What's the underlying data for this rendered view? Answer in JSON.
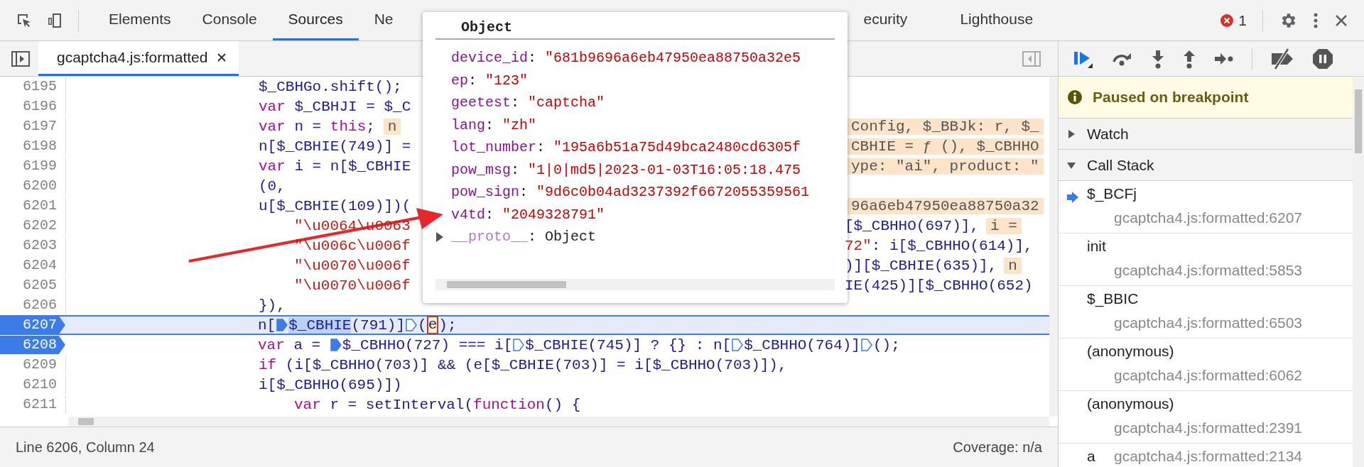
{
  "toolbar": {
    "tabs": [
      {
        "label": "Elements",
        "selected": false
      },
      {
        "label": "Console",
        "selected": false
      },
      {
        "label": "Sources",
        "selected": true
      },
      {
        "label": "Ne",
        "selected": false
      }
    ],
    "tabs_beyond_popover": [
      {
        "label": "ecurity",
        "selected": false
      },
      {
        "label": "Lighthouse",
        "selected": false
      }
    ],
    "error_count": "1"
  },
  "file_tabs": [
    {
      "label": "gcaptcha4.js:formatted",
      "selected": true
    }
  ],
  "code": {
    "lines": [
      {
        "number": "6195",
        "breakpoint": false,
        "current": false,
        "continuation": false,
        "parts": [
          {
            "kind": "code",
            "text": "$_CBHGo.shift();"
          }
        ]
      },
      {
        "number": "6196",
        "breakpoint": false,
        "current": false,
        "continuation": false,
        "parts": [
          {
            "kind": "keyword",
            "text": "var"
          },
          {
            "kind": "code",
            "text": " $_CBHJI = $_C"
          }
        ]
      },
      {
        "number": "6197",
        "breakpoint": false,
        "current": false,
        "continuation": false,
        "parts": [
          {
            "kind": "keyword",
            "text": "var"
          },
          {
            "kind": "code",
            "text": " n = "
          },
          {
            "kind": "keyword",
            "text": "this"
          },
          {
            "kind": "code",
            "text": ";"
          },
          {
            "kind": "inline",
            "text": "n"
          }
        ],
        "right": [
          {
            "kind": "inline",
            "text": "Config, $_BBJk: r, $_"
          }
        ]
      },
      {
        "number": "6198",
        "breakpoint": false,
        "current": false,
        "continuation": false,
        "parts": [
          {
            "kind": "code",
            "text": "n[$_CBHIE(749)] ="
          }
        ],
        "right": [
          {
            "kind": "inline",
            "text": "CBHIE = ƒ (), $_CBHHO"
          }
        ]
      },
      {
        "number": "6199",
        "breakpoint": false,
        "current": false,
        "continuation": false,
        "parts": [
          {
            "kind": "keyword",
            "text": "var"
          },
          {
            "kind": "code",
            "text": " i = n[$_CBHIE"
          }
        ],
        "right": [
          {
            "kind": "inline",
            "text": "ype: \"ai\", product: \""
          }
        ]
      },
      {
        "number": "6200",
        "breakpoint": false,
        "current": false,
        "continuation": false,
        "parts": [
          {
            "kind": "code",
            "text": "(0,"
          }
        ]
      },
      {
        "number": "6201",
        "breakpoint": false,
        "current": false,
        "continuation": false,
        "parts": [
          {
            "kind": "code",
            "text": "u[$_CBHIE(109)])("
          }
        ],
        "right": [
          {
            "kind": "inline",
            "text": "96a6eb47950ea88750a32"
          }
        ]
      },
      {
        "number": "6202",
        "breakpoint": false,
        "current": false,
        "continuation": true,
        "parts": [
          {
            "kind": "string",
            "text": "\"\\u0064\\u0063"
          }
        ],
        "right": [
          {
            "kind": "code",
            "text": "[$_CBHHO(697)],"
          },
          {
            "kind": "inline",
            "text": "i ="
          }
        ]
      },
      {
        "number": "6203",
        "breakpoint": false,
        "current": false,
        "continuation": true,
        "parts": [
          {
            "kind": "string",
            "text": "\"\\u006c\\u006f"
          }
        ],
        "right": [
          {
            "kind": "string",
            "text": "72\""
          },
          {
            "kind": "code",
            "text": ": i[$_CBHHO(614)],"
          }
        ]
      },
      {
        "number": "6204",
        "breakpoint": false,
        "current": false,
        "continuation": true,
        "parts": [
          {
            "kind": "string",
            "text": "\"\\u0070\\u006f"
          }
        ],
        "right": [
          {
            "kind": "code",
            "text": ")][$_CBHIE(635)],"
          },
          {
            "kind": "inline",
            "text": "n"
          }
        ]
      },
      {
        "number": "6205",
        "breakpoint": false,
        "current": false,
        "continuation": true,
        "parts": [
          {
            "kind": "string",
            "text": "\"\\u0070\\u006f"
          }
        ],
        "right": [
          {
            "kind": "code",
            "text": "IE(425)][$_CBHHO(652)"
          }
        ]
      },
      {
        "number": "6206",
        "breakpoint": false,
        "current": false,
        "continuation": false,
        "parts": [
          {
            "kind": "code",
            "text": "}),"
          }
        ]
      },
      {
        "number": "6207",
        "breakpoint": true,
        "current": true,
        "continuation": false,
        "parts": [
          {
            "kind": "code",
            "text": "n["
          },
          {
            "kind": "marker",
            "active": true
          },
          {
            "kind": "selection",
            "text": "$_CBHIE"
          },
          {
            "kind": "code",
            "text": "(791)]"
          },
          {
            "kind": "marker",
            "active": false
          },
          {
            "kind": "code",
            "text": "("
          },
          {
            "kind": "hover",
            "text": "e"
          },
          {
            "kind": "code",
            "text": ");"
          }
        ]
      },
      {
        "number": "6208",
        "breakpoint": true,
        "current": false,
        "continuation": false,
        "parts": [
          {
            "kind": "keyword",
            "text": "var"
          },
          {
            "kind": "code",
            "text": " a = "
          },
          {
            "kind": "marker",
            "active": true
          },
          {
            "kind": "code",
            "text": "$_CBHHO(727) === i["
          },
          {
            "kind": "marker",
            "active": false
          },
          {
            "kind": "code",
            "text": "$_CBHIE(745)] ? {} : n["
          },
          {
            "kind": "marker",
            "active": false
          },
          {
            "kind": "code",
            "text": "$_CBHHO(764)]"
          },
          {
            "kind": "marker",
            "active": false
          },
          {
            "kind": "code",
            "text": "();"
          }
        ]
      },
      {
        "number": "6209",
        "breakpoint": false,
        "current": false,
        "continuation": false,
        "parts": [
          {
            "kind": "keyword",
            "text": "if"
          },
          {
            "kind": "code",
            "text": " (i[$_CBHHO(703)] && (e[$_CBHIE(703)] = i[$_CBHHO(703)]),"
          }
        ]
      },
      {
        "number": "6210",
        "breakpoint": false,
        "current": false,
        "continuation": false,
        "parts": [
          {
            "kind": "code",
            "text": "i[$_CBHHO(695)])"
          }
        ]
      },
      {
        "number": "6211",
        "breakpoint": false,
        "current": false,
        "continuation": true,
        "parts": [
          {
            "kind": "keyword",
            "text": "var"
          },
          {
            "kind": "code",
            "text": " r = setInterval("
          },
          {
            "kind": "keyword",
            "text": "function"
          },
          {
            "kind": "code",
            "text": "() {"
          }
        ]
      }
    ]
  },
  "popover": {
    "title": "Object",
    "properties": [
      {
        "key": "device_id",
        "separator": ": ",
        "value": "\"681b9696a6eb47950ea88750a32e5",
        "kind": "string"
      },
      {
        "key": "ep",
        "separator": ": ",
        "value": "\"123\"",
        "kind": "string"
      },
      {
        "key": "geetest",
        "separator": ": ",
        "value": "\"captcha\"",
        "kind": "string"
      },
      {
        "key": "lang",
        "separator": ": ",
        "value": "\"zh\"",
        "kind": "string"
      },
      {
        "key": "lot_number",
        "separator": ": ",
        "value": "\"195a6b51a75d49bca2480cd6305f",
        "kind": "string"
      },
      {
        "key": "pow_msg",
        "separator": ": ",
        "value": "\"1|0|md5|2023-01-03T16:05:18.475",
        "kind": "string"
      },
      {
        "key": "pow_sign",
        "separator": ": ",
        "value": "\"9d6c0b04ad3237392f6672055359561",
        "kind": "string"
      },
      {
        "key": "v4td",
        "separator": ": ",
        "value": "\"2049328791\"",
        "kind": "string"
      },
      {
        "key": "__proto__",
        "separator": ": ",
        "value": "Object",
        "kind": "prototype"
      }
    ]
  },
  "status_bar": {
    "position": "Line 6206, Column 24",
    "coverage": "Coverage: n/a"
  },
  "debugger": {
    "paused_message": "Paused on breakpoint",
    "sections": [
      {
        "title": "Watch",
        "expanded": false
      },
      {
        "title": "Call Stack",
        "expanded": true
      }
    ],
    "call_stack": [
      {
        "function": "$_BCFj",
        "location": "gcaptcha4.js:formatted:6207",
        "selected": true,
        "kind": "stacked"
      },
      {
        "function": "init",
        "location": "gcaptcha4.js:formatted:5853",
        "selected": false,
        "kind": "stacked"
      },
      {
        "function": "$_BBIC",
        "location": "gcaptcha4.js:formatted:6503",
        "selected": false,
        "kind": "stacked"
      },
      {
        "function": "(anonymous)",
        "location": "gcaptcha4.js:formatted:6062",
        "selected": false,
        "kind": "stacked"
      },
      {
        "function": "(anonymous)",
        "location": "gcaptcha4.js:formatted:2391",
        "selected": false,
        "kind": "stacked"
      },
      {
        "function": "a",
        "location": "gcaptcha4.js:formatted:2134",
        "selected": false,
        "kind": "inline"
      }
    ]
  }
}
